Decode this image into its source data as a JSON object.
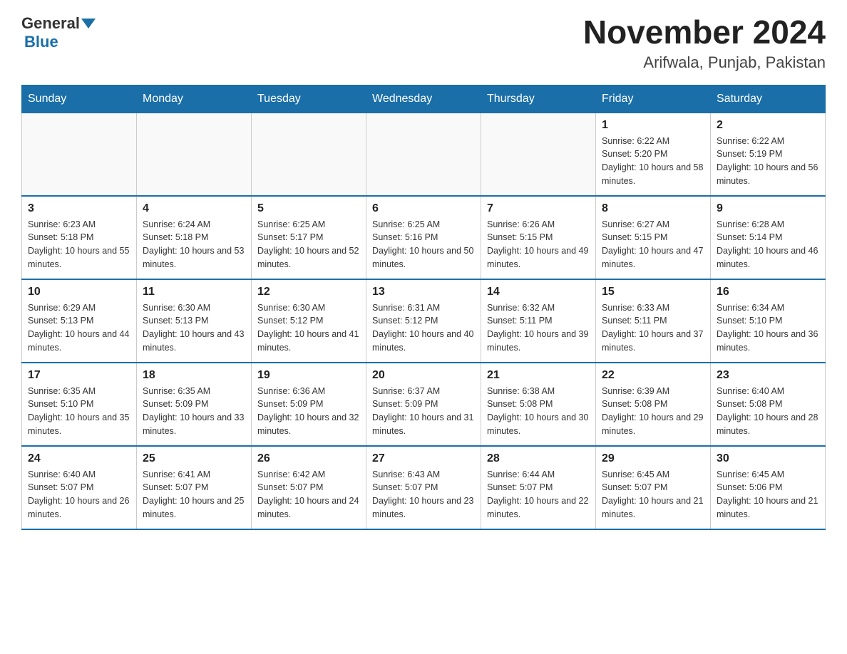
{
  "header": {
    "logo_general": "General",
    "logo_blue": "Blue",
    "title": "November 2024",
    "subtitle": "Arifwala, Punjab, Pakistan"
  },
  "weekdays": [
    "Sunday",
    "Monday",
    "Tuesday",
    "Wednesday",
    "Thursday",
    "Friday",
    "Saturday"
  ],
  "weeks": [
    [
      {
        "day": "",
        "info": ""
      },
      {
        "day": "",
        "info": ""
      },
      {
        "day": "",
        "info": ""
      },
      {
        "day": "",
        "info": ""
      },
      {
        "day": "",
        "info": ""
      },
      {
        "day": "1",
        "info": "Sunrise: 6:22 AM\nSunset: 5:20 PM\nDaylight: 10 hours and 58 minutes."
      },
      {
        "day": "2",
        "info": "Sunrise: 6:22 AM\nSunset: 5:19 PM\nDaylight: 10 hours and 56 minutes."
      }
    ],
    [
      {
        "day": "3",
        "info": "Sunrise: 6:23 AM\nSunset: 5:18 PM\nDaylight: 10 hours and 55 minutes."
      },
      {
        "day": "4",
        "info": "Sunrise: 6:24 AM\nSunset: 5:18 PM\nDaylight: 10 hours and 53 minutes."
      },
      {
        "day": "5",
        "info": "Sunrise: 6:25 AM\nSunset: 5:17 PM\nDaylight: 10 hours and 52 minutes."
      },
      {
        "day": "6",
        "info": "Sunrise: 6:25 AM\nSunset: 5:16 PM\nDaylight: 10 hours and 50 minutes."
      },
      {
        "day": "7",
        "info": "Sunrise: 6:26 AM\nSunset: 5:15 PM\nDaylight: 10 hours and 49 minutes."
      },
      {
        "day": "8",
        "info": "Sunrise: 6:27 AM\nSunset: 5:15 PM\nDaylight: 10 hours and 47 minutes."
      },
      {
        "day": "9",
        "info": "Sunrise: 6:28 AM\nSunset: 5:14 PM\nDaylight: 10 hours and 46 minutes."
      }
    ],
    [
      {
        "day": "10",
        "info": "Sunrise: 6:29 AM\nSunset: 5:13 PM\nDaylight: 10 hours and 44 minutes."
      },
      {
        "day": "11",
        "info": "Sunrise: 6:30 AM\nSunset: 5:13 PM\nDaylight: 10 hours and 43 minutes."
      },
      {
        "day": "12",
        "info": "Sunrise: 6:30 AM\nSunset: 5:12 PM\nDaylight: 10 hours and 41 minutes."
      },
      {
        "day": "13",
        "info": "Sunrise: 6:31 AM\nSunset: 5:12 PM\nDaylight: 10 hours and 40 minutes."
      },
      {
        "day": "14",
        "info": "Sunrise: 6:32 AM\nSunset: 5:11 PM\nDaylight: 10 hours and 39 minutes."
      },
      {
        "day": "15",
        "info": "Sunrise: 6:33 AM\nSunset: 5:11 PM\nDaylight: 10 hours and 37 minutes."
      },
      {
        "day": "16",
        "info": "Sunrise: 6:34 AM\nSunset: 5:10 PM\nDaylight: 10 hours and 36 minutes."
      }
    ],
    [
      {
        "day": "17",
        "info": "Sunrise: 6:35 AM\nSunset: 5:10 PM\nDaylight: 10 hours and 35 minutes."
      },
      {
        "day": "18",
        "info": "Sunrise: 6:35 AM\nSunset: 5:09 PM\nDaylight: 10 hours and 33 minutes."
      },
      {
        "day": "19",
        "info": "Sunrise: 6:36 AM\nSunset: 5:09 PM\nDaylight: 10 hours and 32 minutes."
      },
      {
        "day": "20",
        "info": "Sunrise: 6:37 AM\nSunset: 5:09 PM\nDaylight: 10 hours and 31 minutes."
      },
      {
        "day": "21",
        "info": "Sunrise: 6:38 AM\nSunset: 5:08 PM\nDaylight: 10 hours and 30 minutes."
      },
      {
        "day": "22",
        "info": "Sunrise: 6:39 AM\nSunset: 5:08 PM\nDaylight: 10 hours and 29 minutes."
      },
      {
        "day": "23",
        "info": "Sunrise: 6:40 AM\nSunset: 5:08 PM\nDaylight: 10 hours and 28 minutes."
      }
    ],
    [
      {
        "day": "24",
        "info": "Sunrise: 6:40 AM\nSunset: 5:07 PM\nDaylight: 10 hours and 26 minutes."
      },
      {
        "day": "25",
        "info": "Sunrise: 6:41 AM\nSunset: 5:07 PM\nDaylight: 10 hours and 25 minutes."
      },
      {
        "day": "26",
        "info": "Sunrise: 6:42 AM\nSunset: 5:07 PM\nDaylight: 10 hours and 24 minutes."
      },
      {
        "day": "27",
        "info": "Sunrise: 6:43 AM\nSunset: 5:07 PM\nDaylight: 10 hours and 23 minutes."
      },
      {
        "day": "28",
        "info": "Sunrise: 6:44 AM\nSunset: 5:07 PM\nDaylight: 10 hours and 22 minutes."
      },
      {
        "day": "29",
        "info": "Sunrise: 6:45 AM\nSunset: 5:07 PM\nDaylight: 10 hours and 21 minutes."
      },
      {
        "day": "30",
        "info": "Sunrise: 6:45 AM\nSunset: 5:06 PM\nDaylight: 10 hours and 21 minutes."
      }
    ]
  ]
}
